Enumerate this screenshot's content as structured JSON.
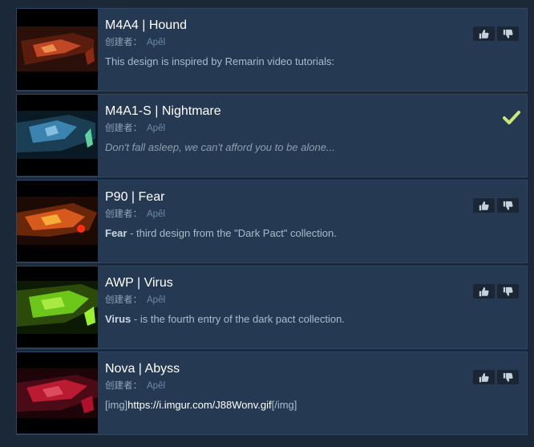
{
  "creator_label": "创建者：",
  "items": [
    {
      "title": "M4A4 | Hound",
      "author": "Apêl",
      "desc_plain": "This design is inspired by Remarin video tutorials:",
      "state": "votes",
      "thumb_accent": "#d2502a"
    },
    {
      "title": "M4A1-S | Nightmare",
      "author": "Apêl",
      "desc_plain": "Don't fall asleep, we can't afford you to be alone...",
      "state": "checked",
      "thumb_accent": "#4aa3d6"
    },
    {
      "title": "P90 | Fear",
      "author": "Apêl",
      "desc_bold": "Fear",
      "desc_rest": " - third design from the \"Dark Pact\" collection.",
      "state": "votes",
      "thumb_accent": "#e8641e"
    },
    {
      "title": "AWP | Virus",
      "author": "Apêl",
      "desc_bold": "Virus",
      "desc_rest": " - is the fourth entry of the dark pact collection.",
      "state": "votes",
      "thumb_accent": "#7ee61e"
    },
    {
      "title": "Nova | Abyss",
      "author": "Apêl",
      "desc_tag_open": "[img]",
      "desc_link": "https://i.imgur.com/J88Wonv.gif",
      "desc_tag_close": "[/img]",
      "state": "votes",
      "thumb_accent": "#e0203c"
    }
  ],
  "icons": {
    "thumbs_up": "thumbs-up-icon",
    "thumbs_down": "thumbs-down-icon",
    "check": "check-icon"
  },
  "colors": {
    "background": "#1b2838",
    "row": "#253a52",
    "check": "#a4d007"
  }
}
